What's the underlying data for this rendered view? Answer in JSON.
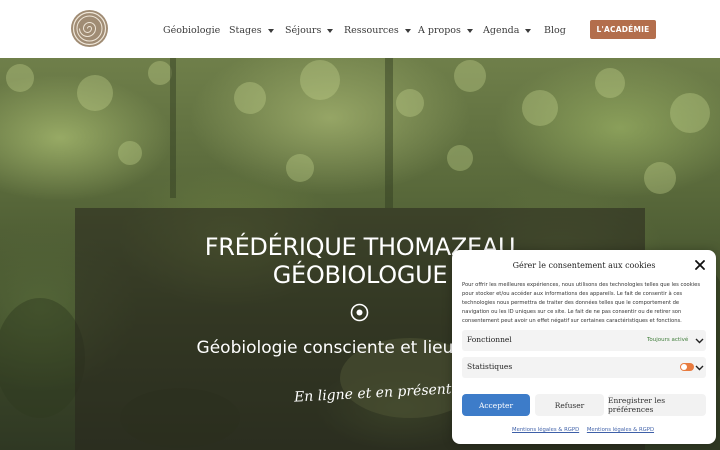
{
  "header": {
    "logo_icon": "spiral-logo-icon",
    "nav": [
      {
        "label": "Géobiologie",
        "has_dropdown": false
      },
      {
        "label": "Stages",
        "has_dropdown": true
      },
      {
        "label": "Séjours",
        "has_dropdown": true
      },
      {
        "label": "Ressources",
        "has_dropdown": true
      },
      {
        "label": "A propos",
        "has_dropdown": true
      },
      {
        "label": "Agenda",
        "has_dropdown": true
      },
      {
        "label": "Blog",
        "has_dropdown": false
      }
    ],
    "cta_label": "L'ACADÉMIE",
    "cta_color": "#b36e4c"
  },
  "hero": {
    "title_line1": "FRÉDÉRIQUE THOMAZEAU",
    "title_line2": "GÉOBIOLOGUE",
    "icon": "target-icon",
    "subtitle": "Géobiologie consciente et lieux sacrés",
    "script_text": "En ligne et en présentiel"
  },
  "cookie_banner": {
    "title": "Gérer le consentement aux cookies",
    "text": "Pour offrir les meilleures expériences, nous utilisons des technologies telles que les cookies pour stocker et/ou accéder aux informations des appareils. Le fait de consentir à ces technologies nous permettra de traiter des données telles que le comportement de navigation ou les ID uniques sur ce site. Le fait de ne pas consentir ou de retirer son consentement peut avoir un effet négatif sur certaines caractéristiques et fonctions.",
    "categories": [
      {
        "label": "Fonctionnel",
        "status": "Toujours activé"
      },
      {
        "label": "Statistiques",
        "status": ""
      }
    ],
    "accept_label": "Accepter",
    "refuse_label": "Refuser",
    "prefs_label": "Enregistrer les préférences",
    "links": [
      "Mentions légales & RGPD",
      "Mentions légales & RGPD"
    ],
    "accent_color": "#3d7cc9",
    "toggle_color": "#e87b3f"
  }
}
